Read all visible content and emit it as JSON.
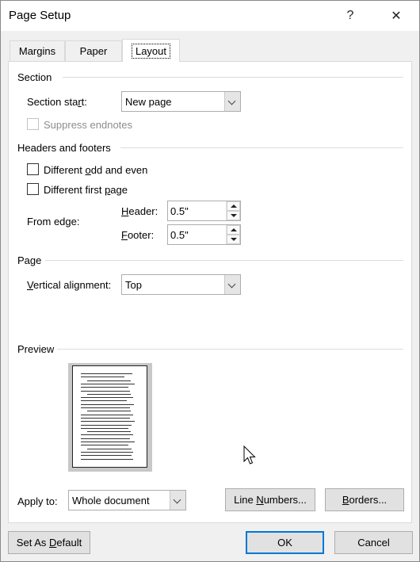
{
  "window": {
    "title": "Page Setup",
    "help_label": "?",
    "close_label": "✕"
  },
  "tabs": [
    {
      "label": "Margins",
      "active": false
    },
    {
      "label": "Paper",
      "active": false
    },
    {
      "label": "Layout",
      "active": true
    }
  ],
  "section": {
    "heading": "Section",
    "section_start_label_a": "Section sta",
    "section_start_label_u": "r",
    "section_start_label_b": "t:",
    "section_start_value": "New page",
    "suppress_endnotes_label": "Suppress endnotes",
    "suppress_endnotes_checked": false
  },
  "headers_footers": {
    "heading": "Headers and footers",
    "diff_odd_even_a": "Different ",
    "diff_odd_even_u": "o",
    "diff_odd_even_b": "dd and even",
    "diff_odd_even_checked": false,
    "diff_first_a": "Different first ",
    "diff_first_u": "p",
    "diff_first_b": "age",
    "diff_first_checked": false,
    "from_edge_label": "From edge:",
    "header_u": "H",
    "header_rest": "eader:",
    "header_value": "0.5\"",
    "footer_u": "F",
    "footer_rest": "ooter:",
    "footer_value": "0.5\""
  },
  "page": {
    "heading": "Page",
    "valign_u": "V",
    "valign_rest": "ertical alignment:",
    "valign_value": "Top"
  },
  "preview": {
    "heading": "Preview"
  },
  "apply": {
    "label": "Apply to:",
    "value": "Whole document"
  },
  "buttons": {
    "line_numbers_a": "Line ",
    "line_numbers_u": "N",
    "line_numbers_b": "umbers...",
    "borders_u": "B",
    "borders_b": "orders...",
    "set_default_a": "Set As ",
    "set_default_u": "D",
    "set_default_b": "efault",
    "ok": "OK",
    "cancel": "Cancel"
  },
  "colors": {
    "default_button_border": "#0078d7",
    "panel_bg": "#ffffff",
    "dialog_bg": "#f0f0f0"
  }
}
